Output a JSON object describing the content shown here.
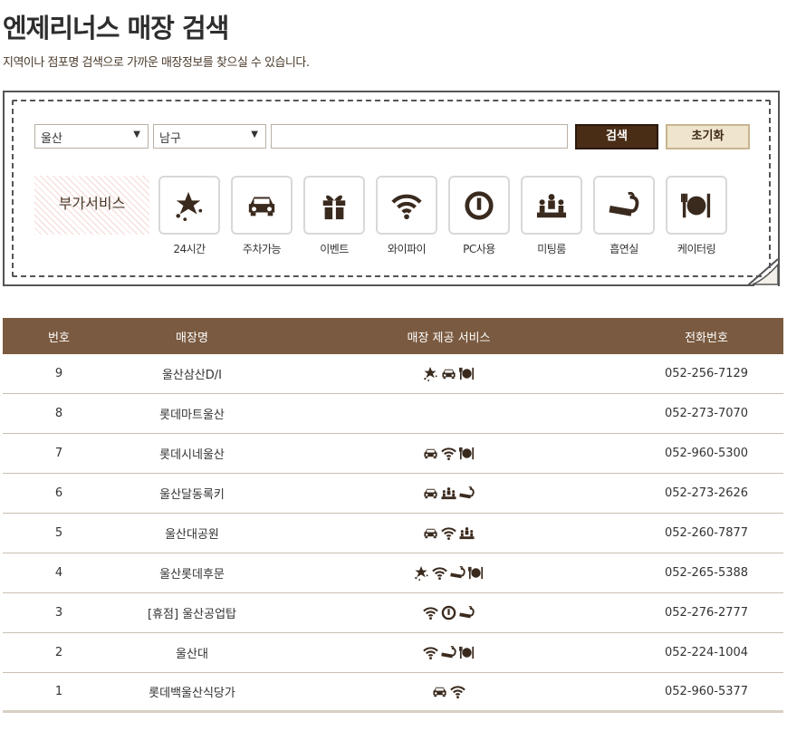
{
  "page": {
    "title": "엔제리너스 매장 검색",
    "subtitle": "지역이나 점포명 검색으로 가까운 매장정보를 찾으실 수 있습니다."
  },
  "search": {
    "region_value": "울산",
    "district_value": "남구",
    "keyword_value": "",
    "search_label": "검색",
    "reset_label": "초기화"
  },
  "services": {
    "label": "부가서비스",
    "items": [
      {
        "icon": "star-24h-icon",
        "label": "24시간"
      },
      {
        "icon": "car-icon",
        "label": "주차가능"
      },
      {
        "icon": "gift-icon",
        "label": "이벤트"
      },
      {
        "icon": "wifi-icon",
        "label": "와이파이"
      },
      {
        "icon": "power-icon",
        "label": "PC사용"
      },
      {
        "icon": "meeting-icon",
        "label": "미팅룸"
      },
      {
        "icon": "smoking-icon",
        "label": "흡연실"
      },
      {
        "icon": "catering-icon",
        "label": "케이터링"
      }
    ]
  },
  "table": {
    "headers": {
      "no": "번호",
      "name": "매장명",
      "services": "매장 제공 서비스",
      "tel": "전화번호"
    },
    "rows": [
      {
        "no": "9",
        "name": "울산삼산D/I",
        "services": [
          "star-24h-icon",
          "car-icon",
          "catering-icon"
        ],
        "tel": "052-256-7129"
      },
      {
        "no": "8",
        "name": "롯데마트울산",
        "services": [],
        "tel": "052-273-7070"
      },
      {
        "no": "7",
        "name": "롯데시네울산",
        "services": [
          "car-icon",
          "wifi-icon",
          "catering-icon"
        ],
        "tel": "052-960-5300"
      },
      {
        "no": "6",
        "name": "울산달동록키",
        "services": [
          "car-icon",
          "meeting-icon",
          "smoking-icon"
        ],
        "tel": "052-273-2626"
      },
      {
        "no": "5",
        "name": "울산대공원",
        "services": [
          "car-icon",
          "wifi-icon",
          "meeting-icon"
        ],
        "tel": "052-260-7877"
      },
      {
        "no": "4",
        "name": "울산롯데후문",
        "services": [
          "star-24h-icon",
          "wifi-icon",
          "smoking-icon",
          "catering-icon"
        ],
        "tel": "052-265-5388"
      },
      {
        "no": "3",
        "name": "[휴점] 울산공업탑",
        "services": [
          "wifi-icon",
          "power-icon",
          "smoking-icon"
        ],
        "tel": "052-276-2777"
      },
      {
        "no": "2",
        "name": "울산대",
        "services": [
          "wifi-icon",
          "smoking-icon",
          "catering-icon"
        ],
        "tel": "052-224-1004"
      },
      {
        "no": "1",
        "name": "롯데백울산식당가",
        "services": [
          "car-icon",
          "wifi-icon"
        ],
        "tel": "052-960-5377"
      }
    ]
  },
  "colors": {
    "header_bg": "#7a5a40",
    "search_btn": "#4a2d15",
    "reset_btn": "#efe4cc"
  }
}
